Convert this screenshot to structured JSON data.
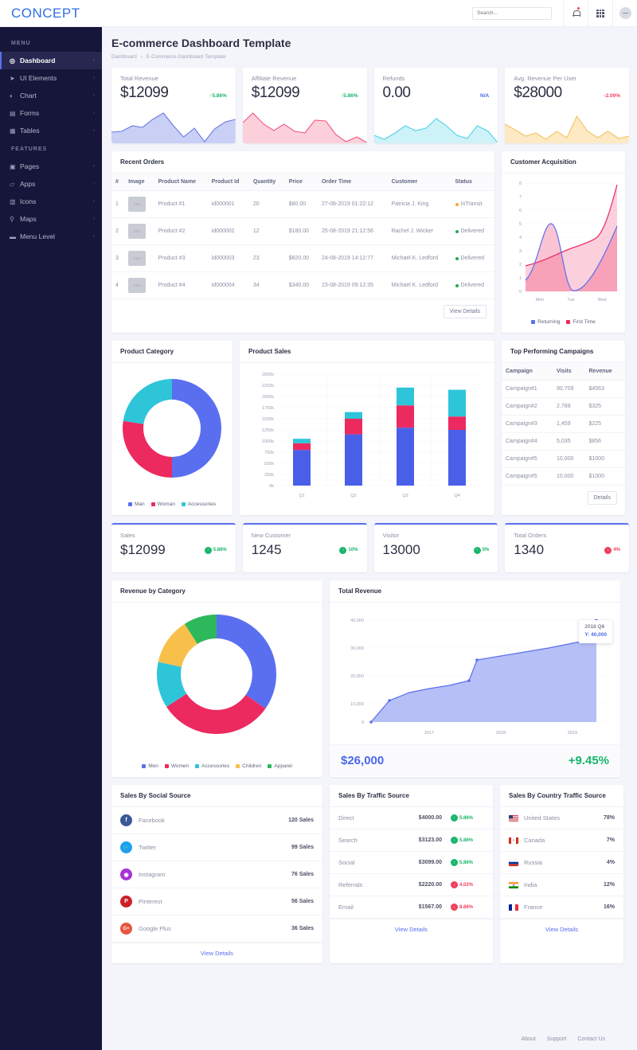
{
  "brand": "CONCEPT",
  "header": {
    "search_placeholder": "Search...",
    "bell_icon": "bell-icon",
    "grid_icon": "grid-icon",
    "avatar_icon": "avatar-icon"
  },
  "sidebar": {
    "sections": [
      {
        "label": "MENU",
        "items": [
          {
            "label": "Dashboard",
            "icon": "dashboard-icon",
            "active": true
          },
          {
            "label": "UI Elements",
            "icon": "rocket-icon"
          },
          {
            "label": "Chart",
            "icon": "pie-chart-icon"
          },
          {
            "label": "Forms",
            "icon": "form-icon"
          },
          {
            "label": "Tables",
            "icon": "table-icon"
          }
        ]
      },
      {
        "label": "FEATURES",
        "items": [
          {
            "label": "Pages",
            "icon": "page-icon"
          },
          {
            "label": "Apps",
            "icon": "app-icon"
          },
          {
            "label": "Icons",
            "icon": "icons-icon"
          },
          {
            "label": "Maps",
            "icon": "map-pin-icon"
          },
          {
            "label": "Menu Level",
            "icon": "folder-icon"
          }
        ]
      }
    ]
  },
  "page": {
    "title": "E-commerce Dashboard Template",
    "breadcrumb": [
      "Dashboard",
      "E-Commerce Dashboard Template"
    ]
  },
  "kpi_cards": [
    {
      "label": "Total Revenue",
      "value": "$12099",
      "change": "5.86%",
      "direction": "up",
      "color": "#6b78e8"
    },
    {
      "label": "Affiliate Revenue",
      "value": "$12099",
      "change": "5.86%",
      "direction": "up",
      "color": "#f2567f"
    },
    {
      "label": "Refunds",
      "value": "0.00",
      "change": "N/A",
      "direction": "na",
      "color": "#4fd2e8"
    },
    {
      "label": "Avg. Revenue Per User",
      "value": "$28000",
      "change": "2.00%",
      "direction": "down",
      "color": "#f4c15b"
    }
  ],
  "recent_orders": {
    "title": "Recent Orders",
    "columns": [
      "#",
      "Image",
      "Product Name",
      "Product Id",
      "Quantity",
      "Price",
      "Order Time",
      "Customer",
      "Status"
    ],
    "rows": [
      {
        "num": "1",
        "image": "product-thumb",
        "name": "Product #1",
        "id": "id000001",
        "qty": "20",
        "price": "$80.00",
        "time": "27-08-2019 01:22:12",
        "customer": "Patricia J. King",
        "status": "InTransit",
        "status_color": "#f5a623"
      },
      {
        "num": "2",
        "image": "product-thumb",
        "name": "Product #2",
        "id": "id000002",
        "qty": "12",
        "price": "$180.00",
        "time": "25-08-2019 21:12:56",
        "customer": "Rachel J. Wicker",
        "status": "Delivered",
        "status_color": "#1fab54"
      },
      {
        "num": "3",
        "image": "product-thumb",
        "name": "Product #3",
        "id": "id000003",
        "qty": "23",
        "price": "$820.00",
        "time": "24-08-2019 14:12:77",
        "customer": "Michael K. Ledford",
        "status": "Delivered",
        "status_color": "#1fab54"
      },
      {
        "num": "4",
        "image": "product-thumb",
        "name": "Product #4",
        "id": "id000004",
        "qty": "34",
        "price": "$340.00",
        "time": "23-08-2019 09:12:35",
        "customer": "Michael K. Ledford",
        "status": "Delivered",
        "status_color": "#1fab54"
      }
    ],
    "button": "View Details"
  },
  "campaigns": {
    "title": "Top Performing Campaigns",
    "columns": [
      "Campaign",
      "Visits",
      "Revenue"
    ],
    "rows": [
      {
        "campaign": "Campaign#1",
        "visits": "90,709",
        "revenue": "$4563"
      },
      {
        "campaign": "Campaign#2",
        "visits": "2,789",
        "revenue": "$325"
      },
      {
        "campaign": "Campaign#3",
        "visits": "1,459",
        "revenue": "$225"
      },
      {
        "campaign": "Campaign#4",
        "visits": "5,035",
        "revenue": "$856"
      },
      {
        "campaign": "Campaign#5",
        "visits": "10,000",
        "revenue": "$1000"
      },
      {
        "campaign": "Campaign#5",
        "visits": "10,000",
        "revenue": "$1000"
      }
    ],
    "button": "Details"
  },
  "kpi_cards2": [
    {
      "label": "Sales",
      "value": "$12099",
      "change": "5.86%",
      "direction": "up"
    },
    {
      "label": "New Customer",
      "value": "1245",
      "change": "10%",
      "direction": "up"
    },
    {
      "label": "Visitor",
      "value": "13000",
      "change": "5%",
      "direction": "up"
    },
    {
      "label": "Total Orders",
      "value": "1340",
      "change": "4%",
      "direction": "down"
    }
  ],
  "social": {
    "title": "Sales By Social Source",
    "rows": [
      {
        "name": "Facebook",
        "value": "120 Sales",
        "glyph": "f",
        "color": "#3b5998",
        "icon": "facebook-icon"
      },
      {
        "name": "Twitter",
        "value": "99 Sales",
        "glyph": "t",
        "color": "#1da1f2",
        "icon": "twitter-icon"
      },
      {
        "name": "Instagram",
        "value": "76 Sales",
        "glyph": "◉",
        "color": "#a634d6",
        "icon": "instagram-icon"
      },
      {
        "name": "Pinterest",
        "value": "56 Sales",
        "glyph": "P",
        "color": "#cb2027",
        "icon": "pinterest-icon"
      },
      {
        "name": "Google Plus",
        "value": "36 Sales",
        "glyph": "G+",
        "color": "#e8543f",
        "icon": "google-plus-icon"
      }
    ],
    "link": "View Details"
  },
  "traffic": {
    "title": "Sales By Traffic Source",
    "rows": [
      {
        "name": "Direct",
        "amount": "$4000.00",
        "change": "5.86%",
        "direction": "up"
      },
      {
        "name": "Search",
        "amount": "$3123.00",
        "change": "5.86%",
        "direction": "up"
      },
      {
        "name": "Social",
        "amount": "$3099.00",
        "change": "5.86%",
        "direction": "up"
      },
      {
        "name": "Referrals",
        "amount": "$2220.00",
        "change": "4.02%",
        "direction": "down"
      },
      {
        "name": "Email",
        "amount": "$1567.00",
        "change": "8.86%",
        "direction": "down"
      }
    ],
    "link": "View Details"
  },
  "country": {
    "title": "Sales By Country Traffic Source",
    "rows": [
      {
        "name": "United States",
        "value": "78%",
        "icon": "flag-us-icon"
      },
      {
        "name": "Canada",
        "value": "7%",
        "icon": "flag-ca-icon"
      },
      {
        "name": "Russia",
        "value": "4%",
        "icon": "flag-ru-icon"
      },
      {
        "name": "India",
        "value": "12%",
        "icon": "flag-in-icon"
      },
      {
        "name": "France",
        "value": "16%",
        "icon": "flag-fr-icon"
      }
    ],
    "link": "View Details"
  },
  "total_revenue_panel": {
    "title": "Total Revenue",
    "amount": "$26,000",
    "change": "+9.45%",
    "tooltip_title": "2018 Q6",
    "tooltip_value": "Y: 40,000"
  },
  "footer": {
    "links": [
      "About",
      "Support",
      "Contact Us"
    ]
  },
  "chart_data": [
    {
      "type": "area",
      "name": "total-revenue-sparkline",
      "title": "Total Revenue",
      "values": [
        30,
        32,
        45,
        42,
        60,
        75,
        48,
        22,
        40,
        10,
        38,
        55,
        60
      ],
      "color": "#6b78e8"
    },
    {
      "type": "area",
      "name": "affiliate-revenue-sparkline",
      "title": "Affiliate Revenue",
      "values": [
        55,
        70,
        52,
        40,
        52,
        38,
        36,
        56,
        54,
        32,
        10,
        26,
        8
      ],
      "color": "#f2567f"
    },
    {
      "type": "area",
      "name": "refunds-sparkline",
      "title": "Refunds",
      "values": [
        20,
        12,
        26,
        42,
        30,
        36,
        56,
        40,
        22,
        14,
        40,
        30,
        2
      ],
      "color": "#4fd2e8"
    },
    {
      "type": "area",
      "name": "arpu-sparkline",
      "title": "Avg. Revenue Per User",
      "values": [
        52,
        40,
        26,
        34,
        18,
        36,
        20,
        64,
        34,
        20,
        34,
        18,
        22
      ],
      "color": "#f4c15b"
    },
    {
      "type": "area",
      "name": "customer-acquisition",
      "title": "Customer Acquisition",
      "xlabel": "",
      "ylabel": "",
      "categories": [
        "Mon",
        "Tue",
        "Wed"
      ],
      "ylim": [
        0,
        8
      ],
      "yticks": [
        0,
        1,
        2,
        3,
        4,
        5,
        6,
        7,
        8
      ],
      "legend": [
        "Returning",
        "First Time"
      ],
      "series": [
        {
          "name": "Returning",
          "color": "#5a6ff0",
          "values": [
            0.8,
            4.9,
            1.9,
            4.9
          ]
        },
        {
          "name": "First Time",
          "color": "#ec2a60",
          "values": [
            1.9,
            2.7,
            3.6,
            7.9
          ]
        }
      ]
    },
    {
      "type": "pie",
      "name": "product-category-donut",
      "title": "Product Category",
      "labels": [
        "Man",
        "Woman",
        "Accessories"
      ],
      "values": [
        50,
        25,
        25
      ],
      "colors": [
        "#5a6ff0",
        "#ec2a60",
        "#2ec5d9"
      ],
      "legend_position": "bottom"
    },
    {
      "type": "bar",
      "name": "product-sales-stacked",
      "title": "Product Sales",
      "categories": [
        "Q1",
        "Q2",
        "Q3",
        "Q4"
      ],
      "ylim": [
        0,
        2500
      ],
      "yticks": [
        "0k",
        "250k",
        "500k",
        "750k",
        "1000k",
        "1250k",
        "1500k",
        "1750k",
        "2000k",
        "2250k",
        "2500k"
      ],
      "stacked": true,
      "series": [
        {
          "name": "series-1",
          "color": "#4a5fe8",
          "values": [
            800,
            1150,
            1300,
            1250
          ]
        },
        {
          "name": "series-2",
          "color": "#ec2a60",
          "values": [
            150,
            350,
            500,
            300
          ]
        },
        {
          "name": "series-3",
          "color": "#2ec5d9",
          "values": [
            100,
            150,
            400,
            600
          ]
        }
      ]
    },
    {
      "type": "pie",
      "name": "revenue-by-category-donut",
      "title": "Revenue by Category",
      "labels": [
        "Men",
        "Women",
        "Accessories",
        "Children",
        "Apparel"
      ],
      "values": [
        35,
        25,
        14,
        16,
        10
      ],
      "colors": [
        "#5a6ff0",
        "#ec2a60",
        "#2ec5d9",
        "#f7c04a",
        "#2eb85c"
      ],
      "legend_position": "bottom"
    },
    {
      "type": "area",
      "name": "total-revenue-line",
      "title": "Total Revenue",
      "xticks": [
        "2017",
        "2018",
        "2019"
      ],
      "yticks": [
        "0",
        "10,000",
        "20,000",
        "30,000",
        "40,000"
      ],
      "ylim": [
        0,
        40000
      ],
      "points": [
        0,
        7800,
        10500,
        12000,
        13000,
        14800,
        22200,
        23500,
        25000,
        26500,
        28000,
        29300
      ],
      "color": "#7b8cf5"
    }
  ]
}
